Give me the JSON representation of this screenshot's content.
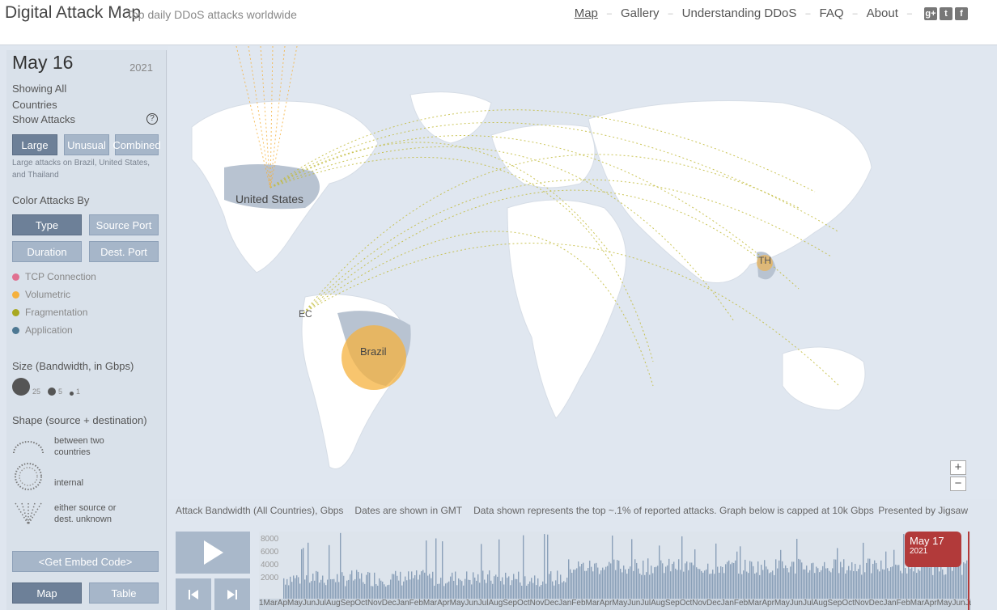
{
  "header": {
    "title": "Digital Attack Map",
    "tagline": "Top daily DDoS attacks worldwide",
    "nav": [
      "Map",
      "Gallery",
      "Understanding DDoS",
      "FAQ",
      "About"
    ],
    "social": [
      "g+",
      "t",
      "f"
    ]
  },
  "sidebar": {
    "date": "May 16",
    "year": "2021",
    "showing": "Showing All Countries",
    "show_attacks_label": "Show Attacks",
    "help": "?",
    "attack_buttons": [
      "Large",
      "Unusual",
      "Combined"
    ],
    "attack_note": "Large attacks on Brazil, United States, and Thailand",
    "color_by_label": "Color Attacks By",
    "color_buttons": [
      "Type",
      "Source Port",
      "Duration",
      "Dest. Port"
    ],
    "types": [
      {
        "label": "TCP Connection",
        "color": "#e07090"
      },
      {
        "label": "Volumetric",
        "color": "#f5b13d"
      },
      {
        "label": "Fragmentation",
        "color": "#a8a820"
      },
      {
        "label": "Application",
        "color": "#4d7893"
      }
    ],
    "size_label": "Size (Bandwidth, in Gbps)",
    "sizes": [
      "25",
      "5",
      "1"
    ],
    "shape_label": "Shape (source + destination)",
    "shapes": [
      "between two countries",
      "internal",
      "either source or dest. unknown"
    ],
    "embed_label": "<Get Embed Code>",
    "view_buttons": [
      "Map",
      "Table"
    ]
  },
  "map": {
    "labels": [
      "United States",
      "Brazil",
      "TH",
      "EC"
    ],
    "zoom_in": "+",
    "zoom_out": "−"
  },
  "infobar": {
    "bandwidth": "Attack Bandwidth (All Countries), Gbps",
    "dates": "Dates are shown in GMT",
    "data_note": "Data shown represents the top ~.1% of reported attacks. Graph below is capped at 10k Gbps",
    "presented": "Presented by Jigsaw"
  },
  "timeline": {
    "ticks": [
      "8000",
      "6000",
      "4000",
      "2000"
    ],
    "current_date": "May 17",
    "current_year": "2021",
    "month_strip": "1MarApMayJunJulAugSepOctNovDecJanFebMarAprMayJunJulAugSepOctNovDecJanFebMarAprMayJunJulAugSepOctNovDecJanFebMarAprMayJunJulAugSepOctNovDecJanFebMarAprMayJunJulAugSepOctNovDecJanFebMarAprMay"
  }
}
